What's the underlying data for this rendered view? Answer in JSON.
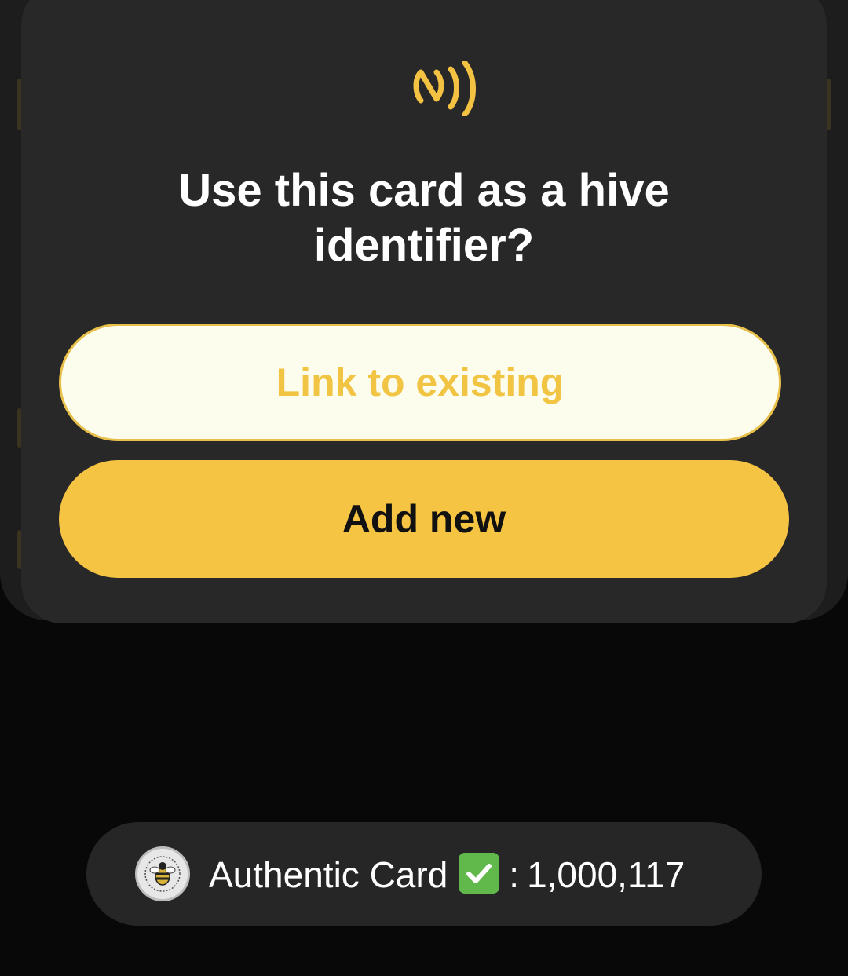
{
  "dialog": {
    "icon": "nfc-icon",
    "title": "Use this card as a hive identifier?",
    "link_button_label": "Link to existing",
    "add_button_label": "Add new"
  },
  "auth_banner": {
    "badge_icon": "bee-badge-icon",
    "label": "Authentic Card",
    "check_icon": "checkmark-icon",
    "separator": ":",
    "value": "1,000,117"
  },
  "colors": {
    "accent": "#f5c443",
    "dialog_bg": "#282828",
    "page_bg": "#080808",
    "link_button_bg": "#fdfdee"
  }
}
